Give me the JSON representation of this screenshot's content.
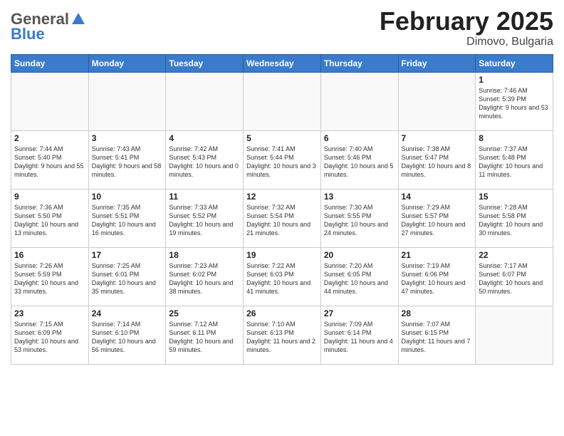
{
  "header": {
    "logo_general": "General",
    "logo_blue": "Blue",
    "month_title": "February 2025",
    "location": "Dimovo, Bulgaria"
  },
  "weekdays": [
    "Sunday",
    "Monday",
    "Tuesday",
    "Wednesday",
    "Thursday",
    "Friday",
    "Saturday"
  ],
  "weeks": [
    [
      {
        "day": "",
        "info": ""
      },
      {
        "day": "",
        "info": ""
      },
      {
        "day": "",
        "info": ""
      },
      {
        "day": "",
        "info": ""
      },
      {
        "day": "",
        "info": ""
      },
      {
        "day": "",
        "info": ""
      },
      {
        "day": "1",
        "info": "Sunrise: 7:46 AM\nSunset: 5:39 PM\nDaylight: 9 hours and 53 minutes."
      }
    ],
    [
      {
        "day": "2",
        "info": "Sunrise: 7:44 AM\nSunset: 5:40 PM\nDaylight: 9 hours and 55 minutes."
      },
      {
        "day": "3",
        "info": "Sunrise: 7:43 AM\nSunset: 5:41 PM\nDaylight: 9 hours and 58 minutes."
      },
      {
        "day": "4",
        "info": "Sunrise: 7:42 AM\nSunset: 5:43 PM\nDaylight: 10 hours and 0 minutes."
      },
      {
        "day": "5",
        "info": "Sunrise: 7:41 AM\nSunset: 5:44 PM\nDaylight: 10 hours and 3 minutes."
      },
      {
        "day": "6",
        "info": "Sunrise: 7:40 AM\nSunset: 5:46 PM\nDaylight: 10 hours and 5 minutes."
      },
      {
        "day": "7",
        "info": "Sunrise: 7:38 AM\nSunset: 5:47 PM\nDaylight: 10 hours and 8 minutes."
      },
      {
        "day": "8",
        "info": "Sunrise: 7:37 AM\nSunset: 5:48 PM\nDaylight: 10 hours and 11 minutes."
      }
    ],
    [
      {
        "day": "9",
        "info": "Sunrise: 7:36 AM\nSunset: 5:50 PM\nDaylight: 10 hours and 13 minutes."
      },
      {
        "day": "10",
        "info": "Sunrise: 7:35 AM\nSunset: 5:51 PM\nDaylight: 10 hours and 16 minutes."
      },
      {
        "day": "11",
        "info": "Sunrise: 7:33 AM\nSunset: 5:52 PM\nDaylight: 10 hours and 19 minutes."
      },
      {
        "day": "12",
        "info": "Sunrise: 7:32 AM\nSunset: 5:54 PM\nDaylight: 10 hours and 21 minutes."
      },
      {
        "day": "13",
        "info": "Sunrise: 7:30 AM\nSunset: 5:55 PM\nDaylight: 10 hours and 24 minutes."
      },
      {
        "day": "14",
        "info": "Sunrise: 7:29 AM\nSunset: 5:57 PM\nDaylight: 10 hours and 27 minutes."
      },
      {
        "day": "15",
        "info": "Sunrise: 7:28 AM\nSunset: 5:58 PM\nDaylight: 10 hours and 30 minutes."
      }
    ],
    [
      {
        "day": "16",
        "info": "Sunrise: 7:26 AM\nSunset: 5:59 PM\nDaylight: 10 hours and 33 minutes."
      },
      {
        "day": "17",
        "info": "Sunrise: 7:25 AM\nSunset: 6:01 PM\nDaylight: 10 hours and 35 minutes."
      },
      {
        "day": "18",
        "info": "Sunrise: 7:23 AM\nSunset: 6:02 PM\nDaylight: 10 hours and 38 minutes."
      },
      {
        "day": "19",
        "info": "Sunrise: 7:22 AM\nSunset: 6:03 PM\nDaylight: 10 hours and 41 minutes."
      },
      {
        "day": "20",
        "info": "Sunrise: 7:20 AM\nSunset: 6:05 PM\nDaylight: 10 hours and 44 minutes."
      },
      {
        "day": "21",
        "info": "Sunrise: 7:19 AM\nSunset: 6:06 PM\nDaylight: 10 hours and 47 minutes."
      },
      {
        "day": "22",
        "info": "Sunrise: 7:17 AM\nSunset: 6:07 PM\nDaylight: 10 hours and 50 minutes."
      }
    ],
    [
      {
        "day": "23",
        "info": "Sunrise: 7:15 AM\nSunset: 6:09 PM\nDaylight: 10 hours and 53 minutes."
      },
      {
        "day": "24",
        "info": "Sunrise: 7:14 AM\nSunset: 6:10 PM\nDaylight: 10 hours and 56 minutes."
      },
      {
        "day": "25",
        "info": "Sunrise: 7:12 AM\nSunset: 6:11 PM\nDaylight: 10 hours and 59 minutes."
      },
      {
        "day": "26",
        "info": "Sunrise: 7:10 AM\nSunset: 6:13 PM\nDaylight: 11 hours and 2 minutes."
      },
      {
        "day": "27",
        "info": "Sunrise: 7:09 AM\nSunset: 6:14 PM\nDaylight: 11 hours and 4 minutes."
      },
      {
        "day": "28",
        "info": "Sunrise: 7:07 AM\nSunset: 6:15 PM\nDaylight: 11 hours and 7 minutes."
      },
      {
        "day": "",
        "info": ""
      }
    ]
  ]
}
